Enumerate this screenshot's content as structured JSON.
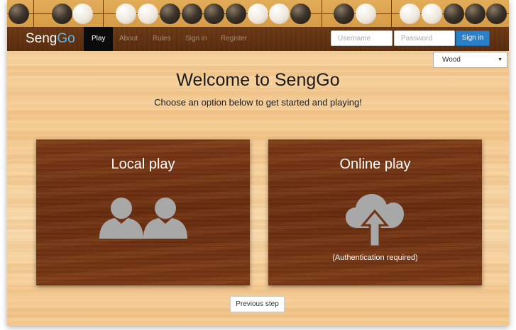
{
  "brand": {
    "name_part1": "Seng",
    "name_part2": "Go"
  },
  "nav": {
    "items": [
      {
        "label": "Play",
        "active": true
      },
      {
        "label": "About",
        "active": false
      },
      {
        "label": "Rules",
        "active": false
      },
      {
        "label": "Sign in",
        "active": false
      },
      {
        "label": "Register",
        "active": false
      }
    ]
  },
  "login": {
    "username_placeholder": "Username",
    "password_placeholder": "Password",
    "signin_label": "Sign in"
  },
  "theme_select": {
    "selected": "Wood"
  },
  "main": {
    "title": "Welcome to SengGo",
    "subtitle": "Choose an option below to get started and playing!"
  },
  "cards": {
    "local": {
      "title": "Local play",
      "icon": "two-users-icon"
    },
    "online": {
      "title": "Online play",
      "icon": "cloud-upload-icon",
      "note": "(Authentication required)"
    }
  },
  "footer": {
    "previous_label": "Previous step"
  },
  "board_stones": [
    "black",
    "black",
    "white",
    "white",
    "white",
    "black",
    "black",
    "black",
    "black",
    "white",
    "white",
    "black",
    "black",
    "white",
    "white",
    "white",
    "black",
    "black",
    "black"
  ],
  "colors": {
    "brand_go": "#5cb6f0",
    "signin_button": "#2a7fc7",
    "card_wood": "#6a2f12",
    "navbar_wood": "#5a2e10",
    "background_wood": "#f4c98f"
  }
}
